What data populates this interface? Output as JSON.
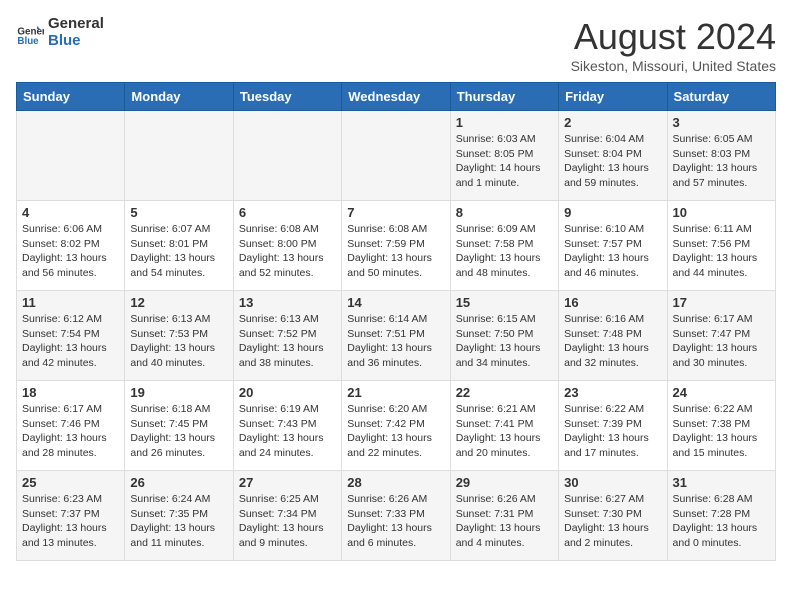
{
  "header": {
    "logo": {
      "general": "General",
      "blue": "Blue"
    },
    "title": "August 2024",
    "subtitle": "Sikeston, Missouri, United States"
  },
  "days_of_week": [
    "Sunday",
    "Monday",
    "Tuesday",
    "Wednesday",
    "Thursday",
    "Friday",
    "Saturday"
  ],
  "weeks": [
    [
      {
        "day": "",
        "info": ""
      },
      {
        "day": "",
        "info": ""
      },
      {
        "day": "",
        "info": ""
      },
      {
        "day": "",
        "info": ""
      },
      {
        "day": "1",
        "sunrise": "6:03 AM",
        "sunset": "8:05 PM",
        "daylight": "14 hours and 1 minute."
      },
      {
        "day": "2",
        "sunrise": "6:04 AM",
        "sunset": "8:04 PM",
        "daylight": "13 hours and 59 minutes."
      },
      {
        "day": "3",
        "sunrise": "6:05 AM",
        "sunset": "8:03 PM",
        "daylight": "13 hours and 57 minutes."
      }
    ],
    [
      {
        "day": "4",
        "sunrise": "6:06 AM",
        "sunset": "8:02 PM",
        "daylight": "13 hours and 56 minutes."
      },
      {
        "day": "5",
        "sunrise": "6:07 AM",
        "sunset": "8:01 PM",
        "daylight": "13 hours and 54 minutes."
      },
      {
        "day": "6",
        "sunrise": "6:08 AM",
        "sunset": "8:00 PM",
        "daylight": "13 hours and 52 minutes."
      },
      {
        "day": "7",
        "sunrise": "6:08 AM",
        "sunset": "7:59 PM",
        "daylight": "13 hours and 50 minutes."
      },
      {
        "day": "8",
        "sunrise": "6:09 AM",
        "sunset": "7:58 PM",
        "daylight": "13 hours and 48 minutes."
      },
      {
        "day": "9",
        "sunrise": "6:10 AM",
        "sunset": "7:57 PM",
        "daylight": "13 hours and 46 minutes."
      },
      {
        "day": "10",
        "sunrise": "6:11 AM",
        "sunset": "7:56 PM",
        "daylight": "13 hours and 44 minutes."
      }
    ],
    [
      {
        "day": "11",
        "sunrise": "6:12 AM",
        "sunset": "7:54 PM",
        "daylight": "13 hours and 42 minutes."
      },
      {
        "day": "12",
        "sunrise": "6:13 AM",
        "sunset": "7:53 PM",
        "daylight": "13 hours and 40 minutes."
      },
      {
        "day": "13",
        "sunrise": "6:13 AM",
        "sunset": "7:52 PM",
        "daylight": "13 hours and 38 minutes."
      },
      {
        "day": "14",
        "sunrise": "6:14 AM",
        "sunset": "7:51 PM",
        "daylight": "13 hours and 36 minutes."
      },
      {
        "day": "15",
        "sunrise": "6:15 AM",
        "sunset": "7:50 PM",
        "daylight": "13 hours and 34 minutes."
      },
      {
        "day": "16",
        "sunrise": "6:16 AM",
        "sunset": "7:48 PM",
        "daylight": "13 hours and 32 minutes."
      },
      {
        "day": "17",
        "sunrise": "6:17 AM",
        "sunset": "7:47 PM",
        "daylight": "13 hours and 30 minutes."
      }
    ],
    [
      {
        "day": "18",
        "sunrise": "6:17 AM",
        "sunset": "7:46 PM",
        "daylight": "13 hours and 28 minutes."
      },
      {
        "day": "19",
        "sunrise": "6:18 AM",
        "sunset": "7:45 PM",
        "daylight": "13 hours and 26 minutes."
      },
      {
        "day": "20",
        "sunrise": "6:19 AM",
        "sunset": "7:43 PM",
        "daylight": "13 hours and 24 minutes."
      },
      {
        "day": "21",
        "sunrise": "6:20 AM",
        "sunset": "7:42 PM",
        "daylight": "13 hours and 22 minutes."
      },
      {
        "day": "22",
        "sunrise": "6:21 AM",
        "sunset": "7:41 PM",
        "daylight": "13 hours and 20 minutes."
      },
      {
        "day": "23",
        "sunrise": "6:22 AM",
        "sunset": "7:39 PM",
        "daylight": "13 hours and 17 minutes."
      },
      {
        "day": "24",
        "sunrise": "6:22 AM",
        "sunset": "7:38 PM",
        "daylight": "13 hours and 15 minutes."
      }
    ],
    [
      {
        "day": "25",
        "sunrise": "6:23 AM",
        "sunset": "7:37 PM",
        "daylight": "13 hours and 13 minutes."
      },
      {
        "day": "26",
        "sunrise": "6:24 AM",
        "sunset": "7:35 PM",
        "daylight": "13 hours and 11 minutes."
      },
      {
        "day": "27",
        "sunrise": "6:25 AM",
        "sunset": "7:34 PM",
        "daylight": "13 hours and 9 minutes."
      },
      {
        "day": "28",
        "sunrise": "6:26 AM",
        "sunset": "7:33 PM",
        "daylight": "13 hours and 6 minutes."
      },
      {
        "day": "29",
        "sunrise": "6:26 AM",
        "sunset": "7:31 PM",
        "daylight": "13 hours and 4 minutes."
      },
      {
        "day": "30",
        "sunrise": "6:27 AM",
        "sunset": "7:30 PM",
        "daylight": "13 hours and 2 minutes."
      },
      {
        "day": "31",
        "sunrise": "6:28 AM",
        "sunset": "7:28 PM",
        "daylight": "13 hours and 0 minutes."
      }
    ]
  ]
}
